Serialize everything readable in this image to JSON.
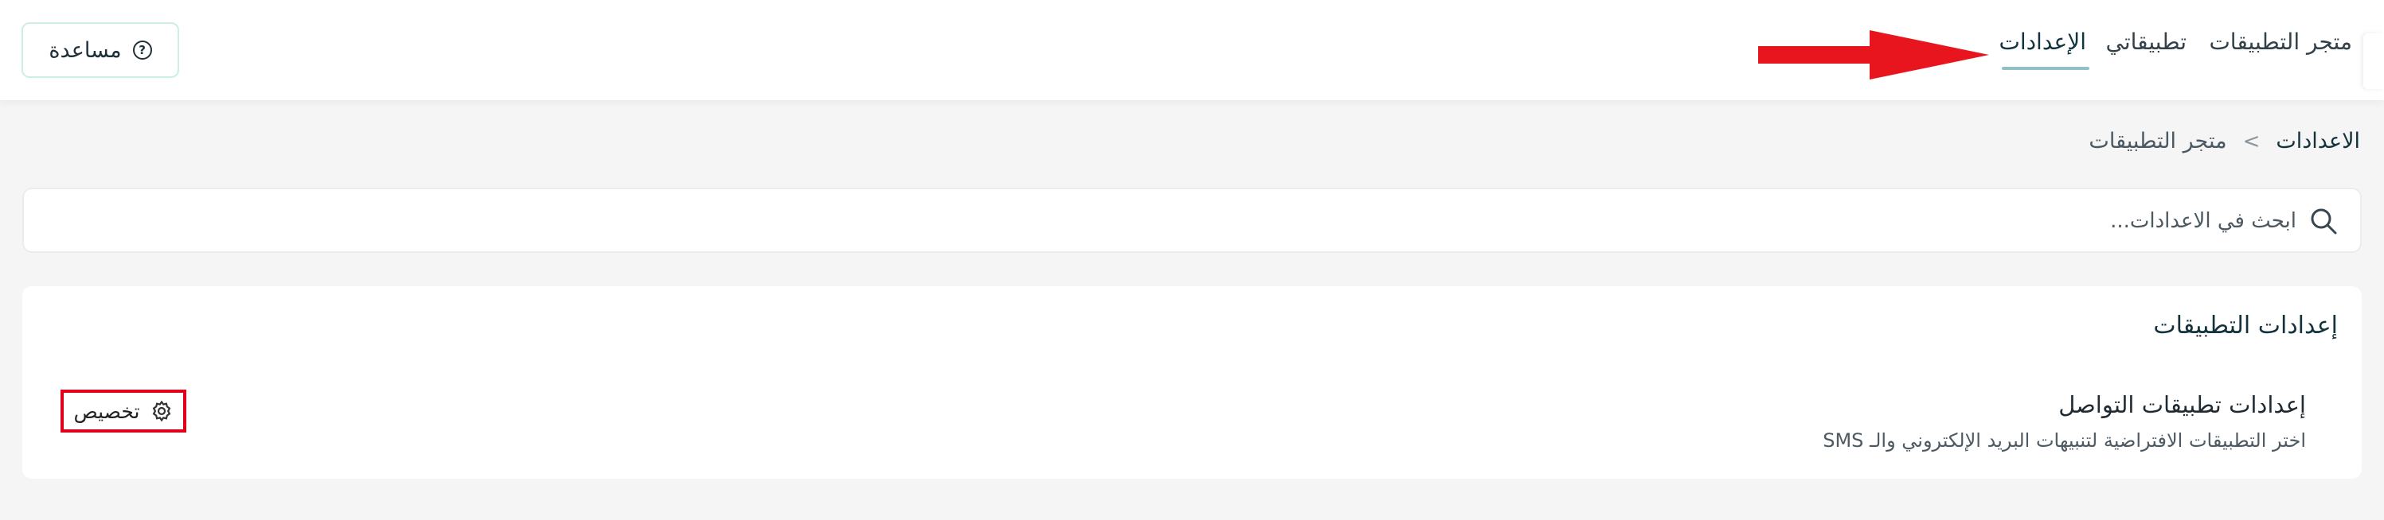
{
  "header": {
    "tabs": [
      {
        "label": "متجر التطبيقات",
        "active": false
      },
      {
        "label": "تطبيقاتي",
        "active": false
      },
      {
        "label": "الإعدادات",
        "active": true
      }
    ],
    "help_label": "مساعدة",
    "active_underline_color": "#8fc1c6"
  },
  "breadcrumb": {
    "parent": "متجر التطبيقات",
    "separator": ">",
    "current": "الاعدادات"
  },
  "search": {
    "placeholder": "ابحث في الاعدادات...",
    "value": ""
  },
  "settings_card": {
    "title": "إعدادات التطبيقات",
    "item": {
      "title": "إعدادات تطبيقات التواصل",
      "description": "اختر التطبيقات الافتراضية لتنبيهات البريد الإلكتروني والـ SMS",
      "action_label": "تخصيص"
    }
  },
  "annotations": {
    "arrow_color": "#e8141e",
    "highlight_color": "#e0001a"
  }
}
